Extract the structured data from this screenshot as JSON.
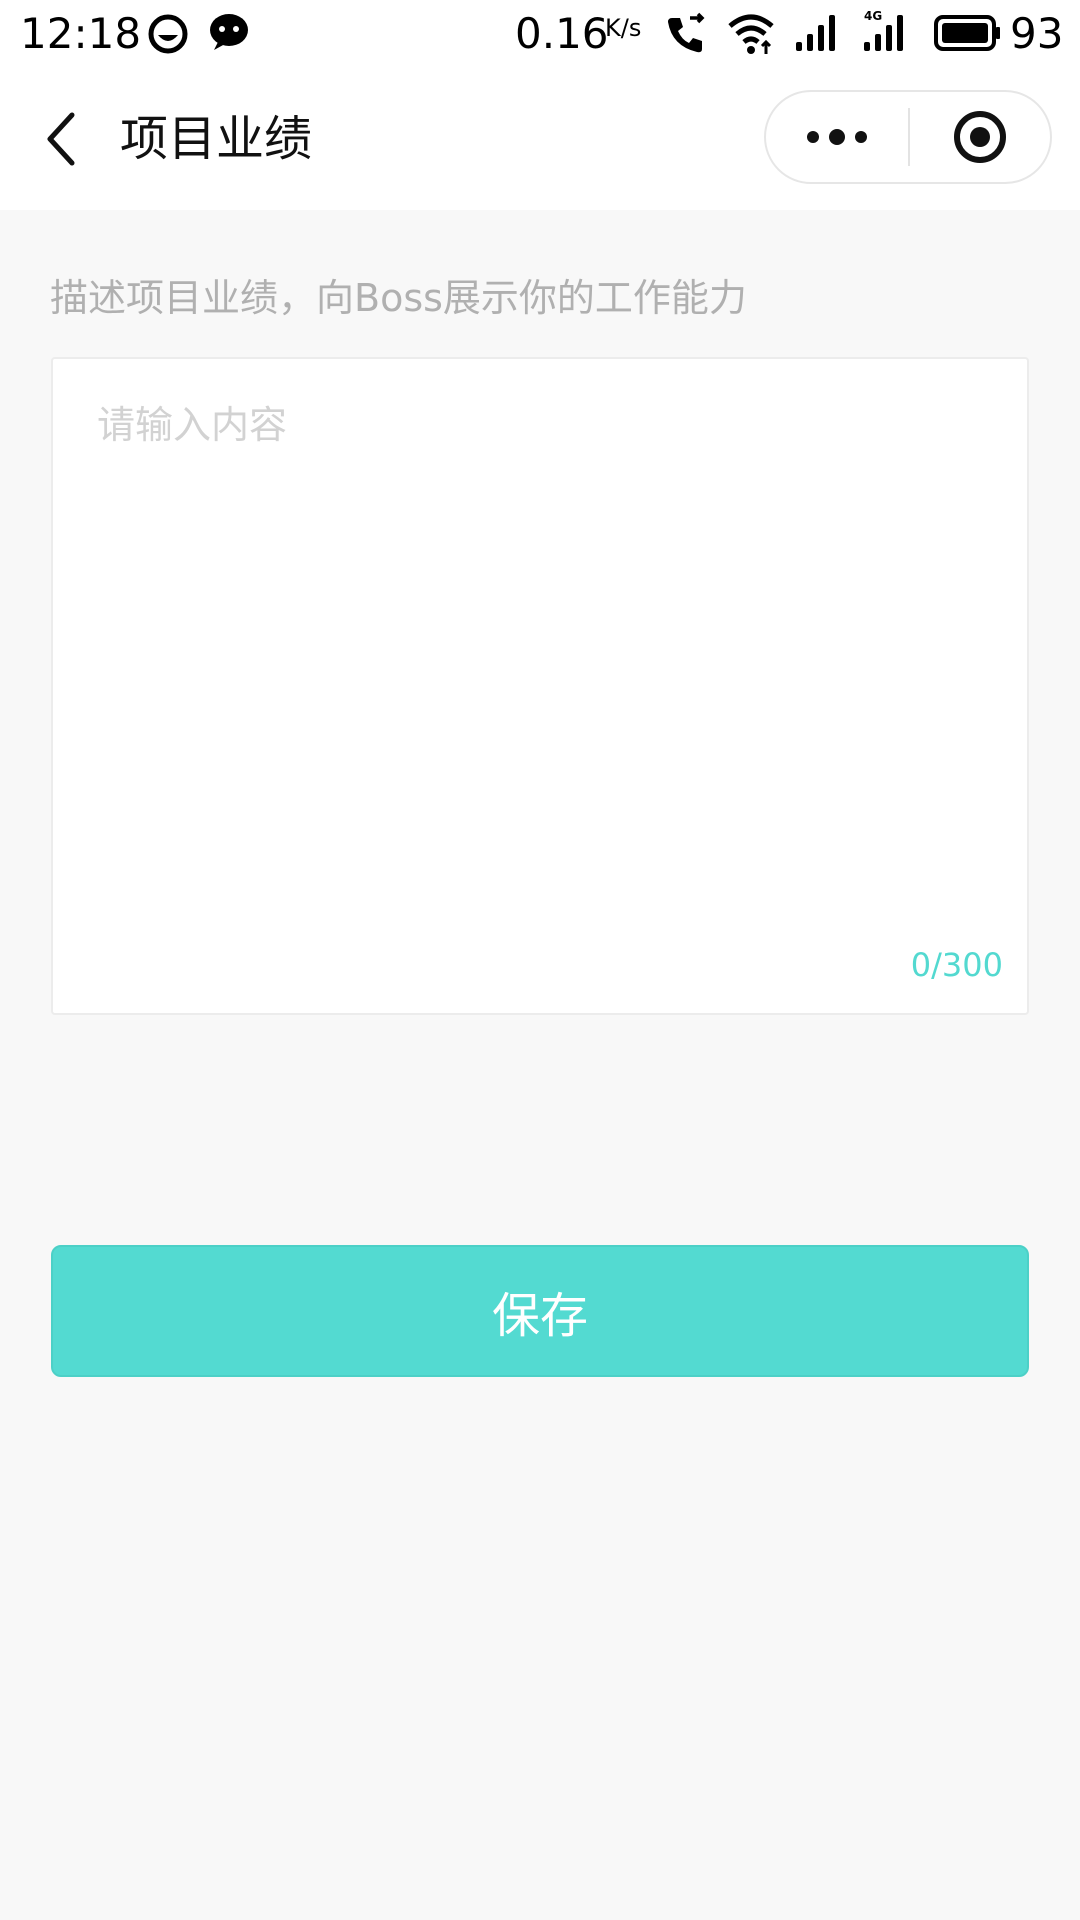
{
  "status_bar": {
    "time": "12:18",
    "speed_value": "0.16",
    "speed_unit": "K/s",
    "battery_level": "93",
    "icons": [
      "smile-face-icon",
      "wechat-icon",
      "call-forward-icon",
      "wifi-icon",
      "signal-icon",
      "signal-4g-icon",
      "battery-icon"
    ]
  },
  "nav": {
    "back_icon": "chevron-left-icon",
    "title": "项目业绩",
    "more_icon": "more-dots-icon",
    "close_icon": "record-circle-icon"
  },
  "content": {
    "hint": "描述项目业绩，向Boss展示你的工作能力",
    "input_placeholder": "请输入内容",
    "input_value": "",
    "counter": "0/300"
  },
  "actions": {
    "save_label": "保存"
  },
  "colors": {
    "accent": "#53dad1",
    "counter": "#53d9d0",
    "background": "#f8f8f8"
  }
}
